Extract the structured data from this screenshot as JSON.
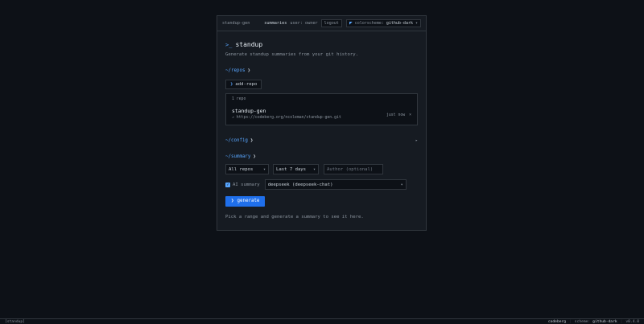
{
  "topbar": {
    "brand": "standup-gen",
    "summaries": "summaries",
    "user": "user: owner",
    "logout": "logout",
    "colorscheme_label": "colorscheme:",
    "colorscheme_value": "github-dark",
    "chevron": "▾"
  },
  "header": {
    "prompt": ">_",
    "title": "standup",
    "subtitle": "Generate standup summaries from your git history."
  },
  "repos": {
    "heading": "~/repos",
    "add_label": "add-repo",
    "count": "1 repo",
    "items": [
      {
        "name": "standup-gen",
        "url": "↗ https://codeberg.org/ncoleman/standup-gen.git",
        "time": "just now",
        "remove": "×"
      }
    ]
  },
  "config": {
    "heading": "~/config",
    "toggle": "▸"
  },
  "summary": {
    "heading": "~/summary",
    "repo_select": "All repos",
    "range_select": "Last 7 days",
    "author_placeholder": "Author (optional)",
    "ai_label": "AI summary",
    "model_select": "deepseek (deepseek-chat)",
    "generate_label": "generate",
    "hint": "Pick a range and generate a summary to see it here."
  },
  "statusbar": {
    "left": "[standup]",
    "host": "codeberg",
    "scheme_label": "scheme:",
    "scheme_value": "github-dark",
    "version": "v0.4.0"
  },
  "colors": {
    "accent": "#58a6ff",
    "primary_button": "#1f6feb",
    "background": "#0d1117",
    "panel": "#161b22",
    "border": "#30363d"
  }
}
